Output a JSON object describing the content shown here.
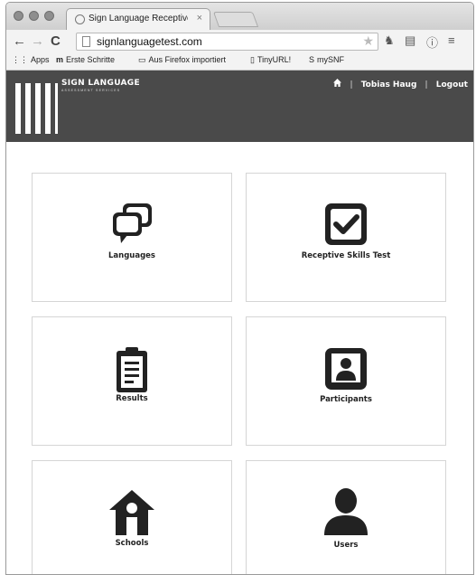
{
  "browser": {
    "tab_title": "Sign Language Receptive",
    "tab_close": "×",
    "url": "signlanguagetest.com"
  },
  "bookmarks": [
    {
      "label": "Apps"
    },
    {
      "label": "Erste Schritte"
    },
    {
      "label": "Aus Firefox importiert"
    },
    {
      "label": "TinyURL!"
    },
    {
      "label": "mySNF"
    }
  ],
  "site": {
    "logo_title": "SIGN LANGUAGE",
    "logo_subtitle": "ASSESSMENT SERVICES",
    "user_name": "Tobias Haug",
    "logout": "Logout",
    "separator": "|"
  },
  "tiles": [
    {
      "label": "Languages",
      "icon": "speech-bubbles-icon"
    },
    {
      "label": "Receptive Skills Test",
      "icon": "checkbox-icon"
    },
    {
      "label": "Results",
      "icon": "clipboard-icon"
    },
    {
      "label": "Participants",
      "icon": "person-card-icon"
    },
    {
      "label": "Schools",
      "icon": "school-house-icon"
    },
    {
      "label": "Users",
      "icon": "user-icon"
    }
  ]
}
